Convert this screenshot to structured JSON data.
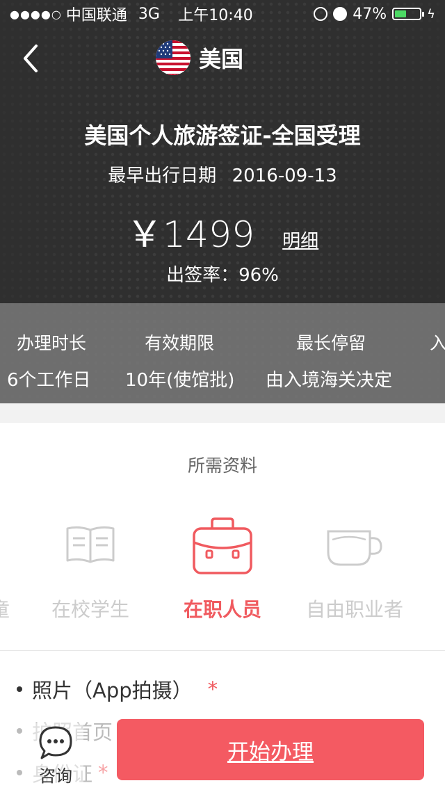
{
  "status_bar": {
    "carrier": "中国联通",
    "network": "3G",
    "time": "上午10:40",
    "battery": "47%",
    "battery_level": 0.47
  },
  "nav": {
    "title": "美国"
  },
  "visa": {
    "title": "美国个人旅游签证-全国受理",
    "date_label": "最早出行日期",
    "date_value": "2016-09-13",
    "price": "￥1499",
    "detail_link": "明细",
    "rate": "出签率：96%"
  },
  "stats": [
    {
      "label": "办理时长",
      "value": "6个工作日"
    },
    {
      "label": "有效期限",
      "value": "10年(使馆批)"
    },
    {
      "label": "最长停留",
      "value": "由入境海关决定"
    },
    {
      "label": "入",
      "value": ""
    }
  ],
  "materials": {
    "title": "所需资料",
    "partial_category": "童",
    "categories": [
      {
        "label": "在校学生",
        "icon": "book-icon",
        "active": false
      },
      {
        "label": "在职人员",
        "icon": "briefcase-icon",
        "active": true
      },
      {
        "label": "自由职业者",
        "icon": "cup-icon",
        "active": false
      }
    ],
    "requirements": [
      {
        "text": "照片（App拍摄）",
        "required": "*"
      },
      {
        "text": "护照首页",
        "required": ""
      },
      {
        "text": "身份证",
        "required": "*"
      }
    ]
  },
  "bottom": {
    "consult_label": "咨询",
    "start_label": "开始办理"
  },
  "colors": {
    "accent": "#f45a62",
    "hero_bg": "#2f2f2f",
    "stats_bg": "#787878"
  }
}
